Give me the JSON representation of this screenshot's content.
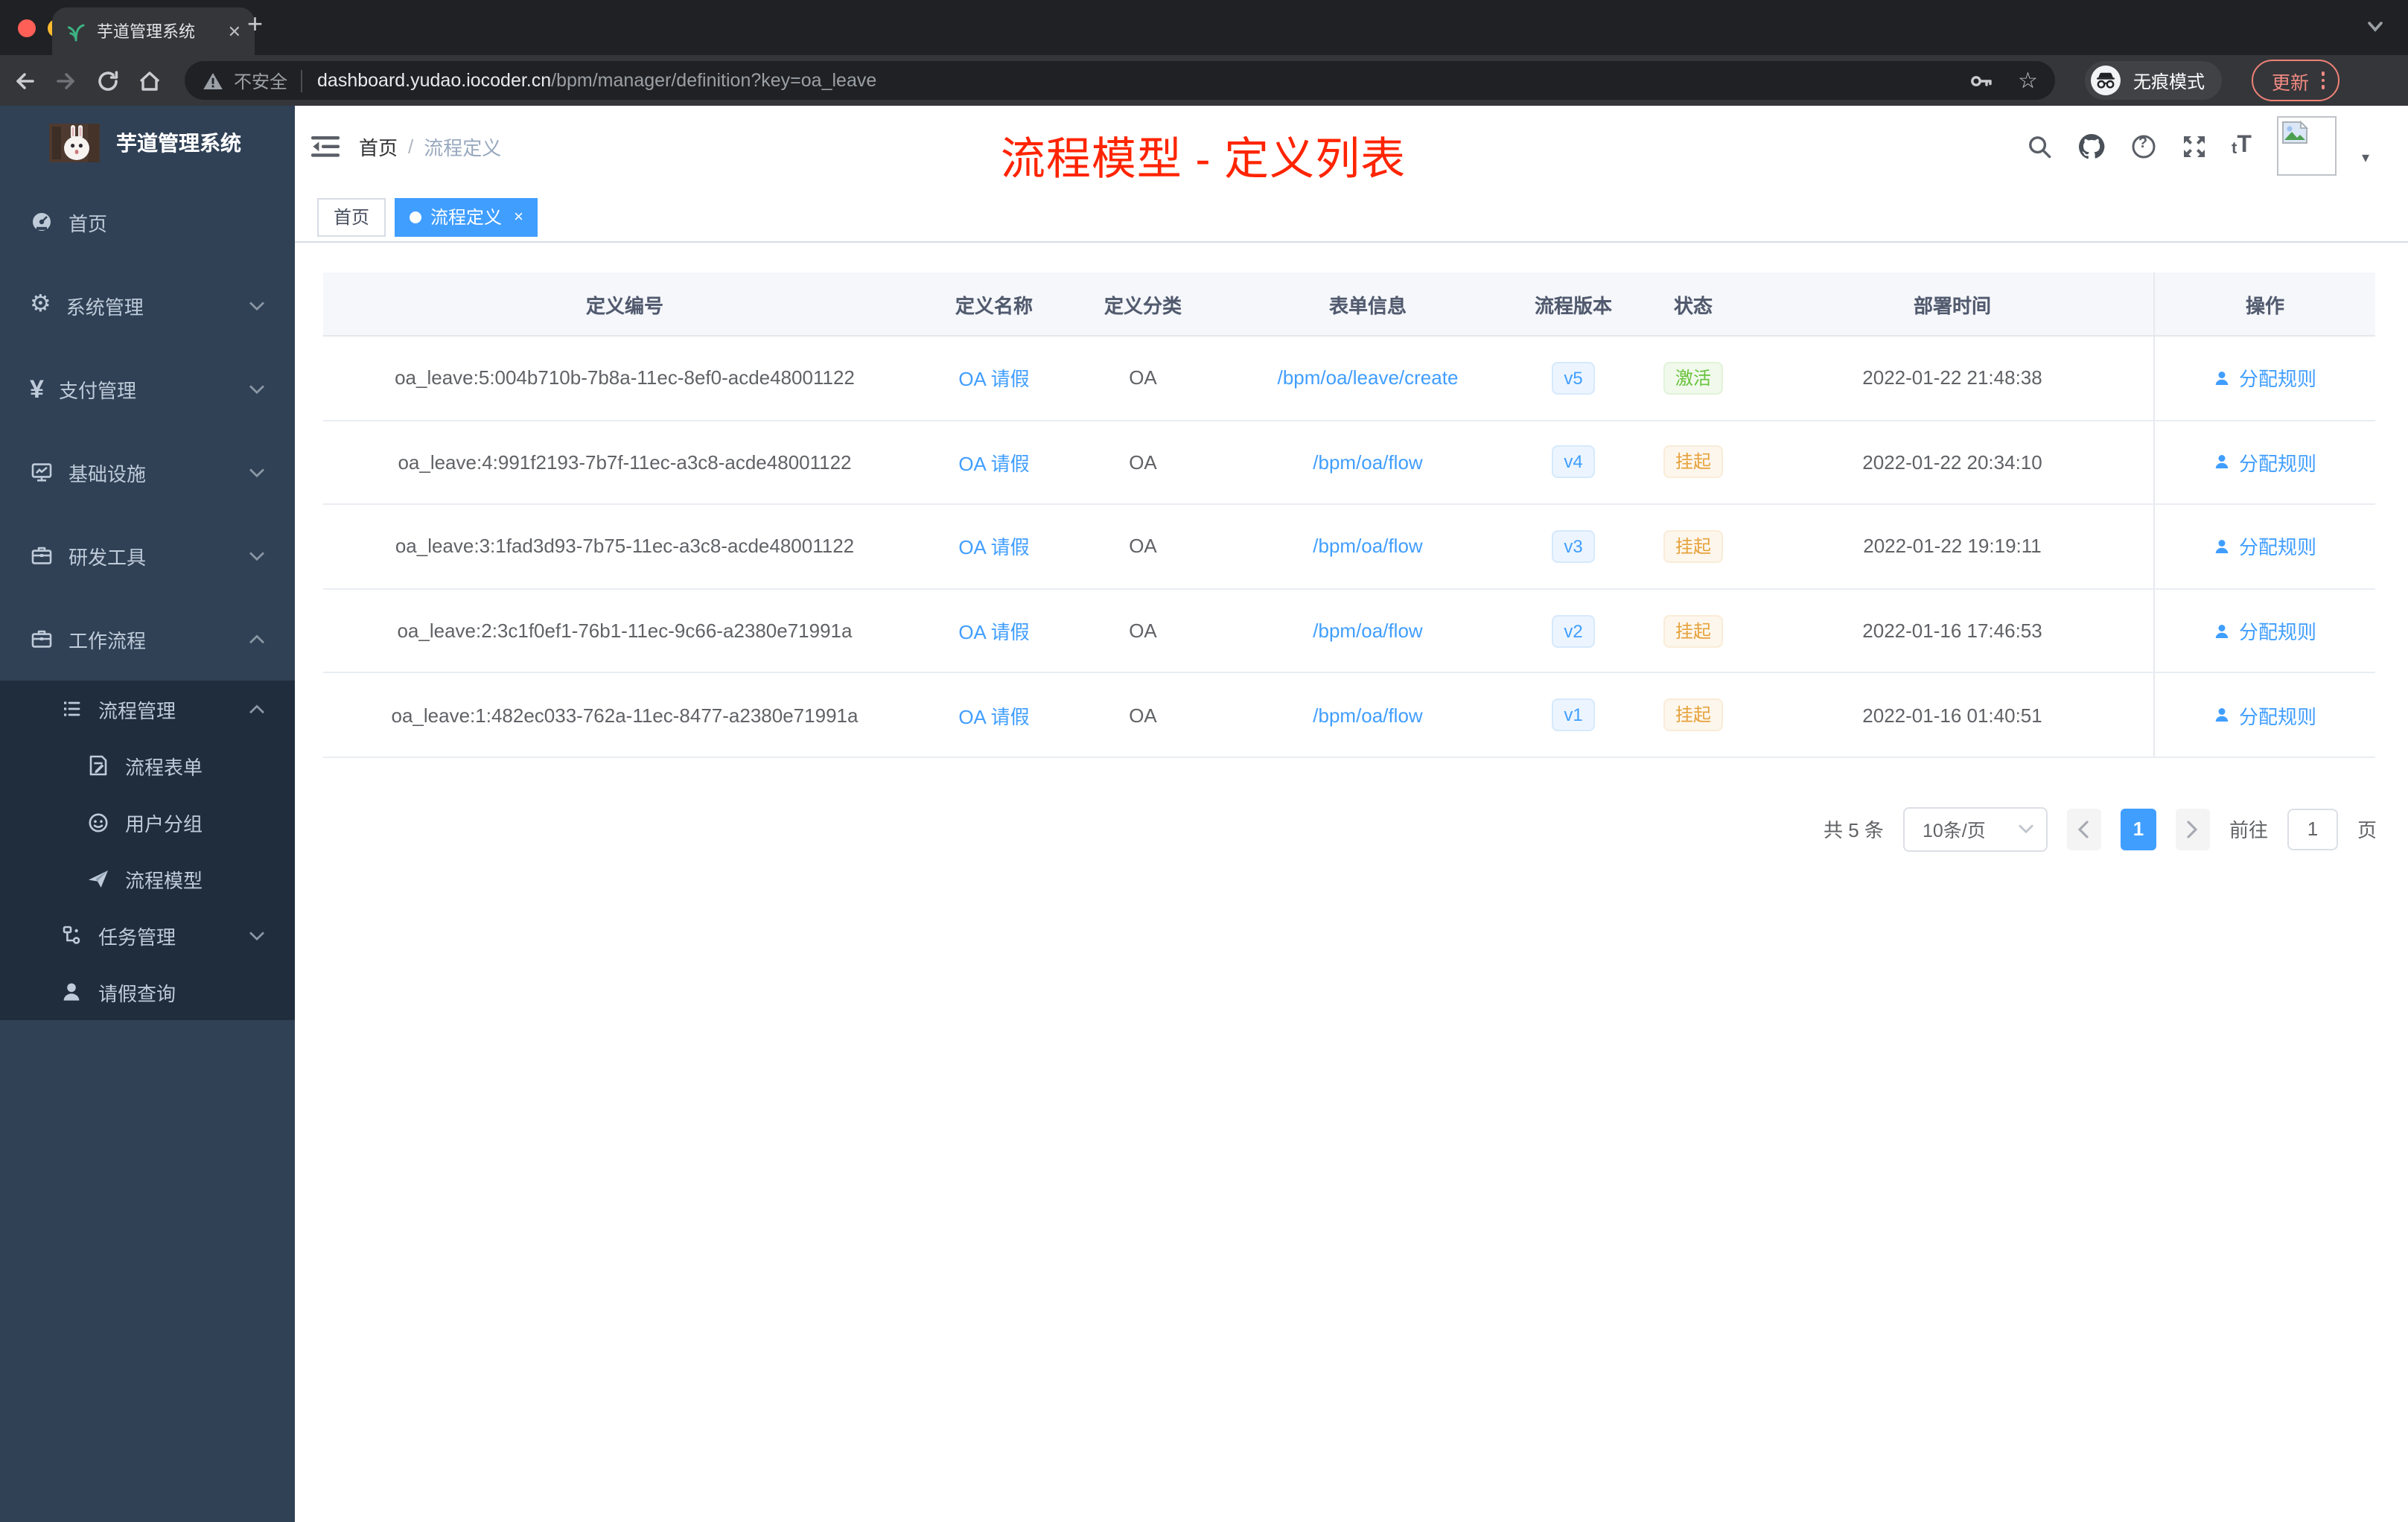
{
  "colors": {
    "accent": "#409eff",
    "title_red": "#ff2400",
    "sidebar_bg": "#304156",
    "submenu_bg": "#1f2d3d",
    "success": "#67c23a",
    "warning": "#e6a23c"
  },
  "browser": {
    "tab_title": "芋道管理系统",
    "security_label": "不安全",
    "url_host": "dashboard.yudao.iocoder.cn",
    "url_path": "/bpm/manager/definition?key=oa_leave",
    "incognito_label": "无痕模式",
    "update_label": "更新"
  },
  "icons": {
    "tab_close": "✕",
    "new_tab": "+",
    "star": "☆",
    "gear": "⚙",
    "yen": "¥",
    "help": "?",
    "caret_down": "▾",
    "font_small": "t",
    "font_big": "T",
    "active_tag_close": "×"
  },
  "sidebar": {
    "app_title": "芋道管理系统",
    "items": [
      {
        "label": "首页"
      },
      {
        "label": "系统管理"
      },
      {
        "label": "支付管理"
      },
      {
        "label": "基础设施"
      },
      {
        "label": "研发工具"
      },
      {
        "label": "工作流程"
      },
      {
        "label": "流程管理"
      },
      {
        "label": "流程表单"
      },
      {
        "label": "用户分组"
      },
      {
        "label": "流程模型"
      },
      {
        "label": "任务管理"
      },
      {
        "label": "请假查询"
      }
    ]
  },
  "header": {
    "breadcrumb_home": "首页",
    "breadcrumb_sep": "/",
    "breadcrumb_current": "流程定义",
    "overlay_title": "流程模型 - 定义列表"
  },
  "tags": [
    {
      "label": "首页",
      "active": false
    },
    {
      "label": "流程定义",
      "active": true
    }
  ],
  "table": {
    "columns": [
      "定义编号",
      "定义名称",
      "定义分类",
      "表单信息",
      "流程版本",
      "状态",
      "部署时间",
      "操作"
    ],
    "action_label": "分配规则",
    "rows": [
      {
        "id": "oa_leave:5:004b710b-7b8a-11ec-8ef0-acde48001122",
        "name": "OA 请假",
        "category": "OA",
        "form": "/bpm/oa/leave/create",
        "version": "v5",
        "status": "激活",
        "time": "2022-01-22 21:48:38"
      },
      {
        "id": "oa_leave:4:991f2193-7b7f-11ec-a3c8-acde48001122",
        "name": "OA 请假",
        "category": "OA",
        "form": "/bpm/oa/flow",
        "version": "v4",
        "status": "挂起",
        "time": "2022-01-22 20:34:10"
      },
      {
        "id": "oa_leave:3:1fad3d93-7b75-11ec-a3c8-acde48001122",
        "name": "OA 请假",
        "category": "OA",
        "form": "/bpm/oa/flow",
        "version": "v3",
        "status": "挂起",
        "time": "2022-01-22 19:19:11"
      },
      {
        "id": "oa_leave:2:3c1f0ef1-76b1-11ec-9c66-a2380e71991a",
        "name": "OA 请假",
        "category": "OA",
        "form": "/bpm/oa/flow",
        "version": "v2",
        "status": "挂起",
        "time": "2022-01-16 17:46:53"
      },
      {
        "id": "oa_leave:1:482ec033-762a-11ec-8477-a2380e71991a",
        "name": "OA 请假",
        "category": "OA",
        "form": "/bpm/oa/flow",
        "version": "v1",
        "status": "挂起",
        "time": "2022-01-16 01:40:51"
      }
    ]
  },
  "pagination": {
    "total_label": "共 5 条",
    "page_size": "10条/页",
    "page": "1",
    "goto_label": "前往",
    "goto_value": "1",
    "unit_label": "页"
  }
}
